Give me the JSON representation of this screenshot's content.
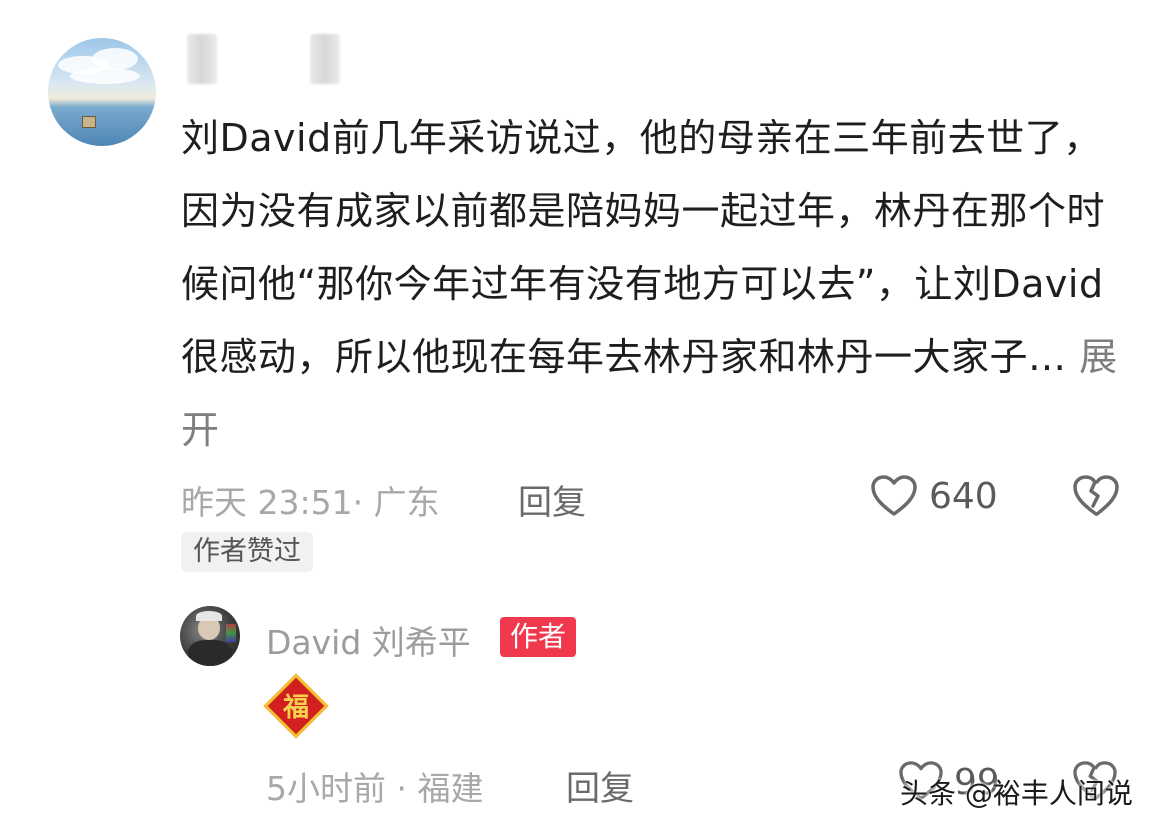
{
  "comment": {
    "text": "刘David前几年采访说过，他的母亲在三年前去世了，因为没有成家以前都是陪妈妈一起过年，林丹在那个时候问他“那你今年过年有没有地方可以去”，让刘David很感动，所以他现在每年去林丹家和林丹一大家子…",
    "expand_label": "展开",
    "timestamp": "昨天 23:51· 广东",
    "reply_label": "回复",
    "like_count": "640",
    "author_liked_badge": "作者赞过"
  },
  "reply": {
    "username": "David 刘希平",
    "author_badge": "作者",
    "emoji_char": "福",
    "timestamp": "5小时前 · 福建",
    "reply_label": "回复",
    "like_count": "99"
  },
  "watermark": "头条 @裕丰人间说",
  "icons": {
    "like": "heart-outline-icon",
    "dislike": "broken-heart-icon",
    "emoji": "fu-blessing-icon"
  },
  "colors": {
    "author_badge_bg": "#f0394c",
    "fu_red": "#d21f1f",
    "fu_gold": "#f2c230"
  }
}
